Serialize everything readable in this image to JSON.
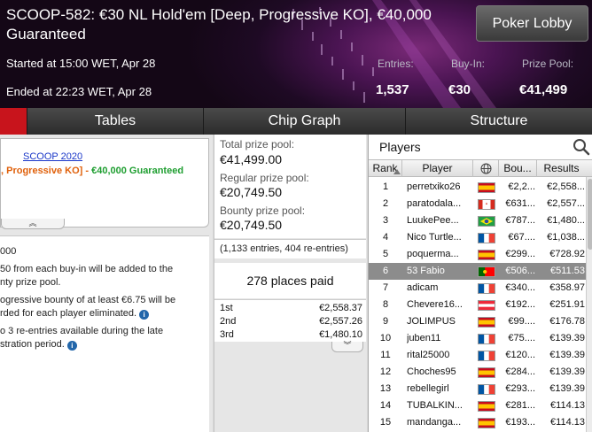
{
  "header": {
    "title": "SCOOP-582: €30 NL Hold'em [Deep, Progressive KO], €40,000 Guaranteed",
    "started": "Started at 15:00 WET, Apr 28",
    "ended": "Ended at 22:23 WET, Apr 28",
    "lobby_button": "Poker Lobby",
    "stats": [
      {
        "label": "Entries:",
        "value": "1,537"
      },
      {
        "label": "Buy-In:",
        "value": "€30"
      },
      {
        "label": "Prize Pool:",
        "value": "€41,499"
      }
    ]
  },
  "tabs": [
    {
      "label": ""
    },
    {
      "label": "Tables"
    },
    {
      "label": "Chip Graph"
    },
    {
      "label": "Structure"
    }
  ],
  "info": {
    "series_link": "SCOOP 2020",
    "name_part": ", Progressive KO] - ",
    "guarantee": "€40,000 Guaranteed",
    "expand_glyph": "︽"
  },
  "rules": [
    "000",
    "50 from each buy-in will be added to the",
    "nty prize pool.",
    "ogressive bounty of at least €6.75 will be",
    "rded for each player eliminated.",
    "o 3 re-entries available during the late",
    "stration period."
  ],
  "info_icon": "i",
  "prize": {
    "total_label": "Total prize pool:",
    "total_value": "€41,499.00",
    "regular_label": "Regular prize pool:",
    "regular_value": "€20,749.50",
    "bounty_label": "Bounty prize pool:",
    "bounty_value": "€20,749.50",
    "entries_note": "(1,133 entries, 404 re-entries)",
    "places_paid": "278 places paid",
    "payouts": [
      {
        "place": "1st",
        "amount": "€2,558.37"
      },
      {
        "place": "2nd",
        "amount": "€2,557.26"
      },
      {
        "place": "3rd",
        "amount": "€1,480.10"
      }
    ],
    "expand_glyph": "︾"
  },
  "players": {
    "title": "Players",
    "columns": {
      "rank": "Rank",
      "player": "Player",
      "bounty": "Bou...",
      "results": "Results"
    },
    "rows": [
      {
        "rank": "1",
        "name": "perretxiko26",
        "flag": "es",
        "bounty": "€2,2...",
        "result": "€2,558..."
      },
      {
        "rank": "2",
        "name": "paratodala...",
        "flag": "ca",
        "bounty": "€631...",
        "result": "€2,557..."
      },
      {
        "rank": "3",
        "name": "LuukePee...",
        "flag": "br",
        "bounty": "€787...",
        "result": "€1,480..."
      },
      {
        "rank": "4",
        "name": "Nico Turtle...",
        "flag": "fr",
        "bounty": "€67....",
        "result": "€1,038..."
      },
      {
        "rank": "5",
        "name": "poquerma...",
        "flag": "es",
        "bounty": "€299...",
        "result": "€728.92"
      },
      {
        "rank": "6",
        "name": "53 Fabio",
        "flag": "pt",
        "bounty": "€506...",
        "result": "€511.53",
        "selected": true
      },
      {
        "rank": "7",
        "name": "adicam",
        "flag": "fr",
        "bounty": "€340...",
        "result": "€358.97"
      },
      {
        "rank": "8",
        "name": "Chevere16...",
        "flag": "at",
        "bounty": "€192...",
        "result": "€251.91"
      },
      {
        "rank": "9",
        "name": "JOLIMPUS",
        "flag": "es",
        "bounty": "€99....",
        "result": "€176.78"
      },
      {
        "rank": "10",
        "name": "juben11",
        "flag": "fr",
        "bounty": "€75....",
        "result": "€139.39"
      },
      {
        "rank": "11",
        "name": "rital25000",
        "flag": "fr",
        "bounty": "€120...",
        "result": "€139.39"
      },
      {
        "rank": "12",
        "name": "Choches95",
        "flag": "es",
        "bounty": "€284...",
        "result": "€139.39"
      },
      {
        "rank": "13",
        "name": "rebellegirl",
        "flag": "fr",
        "bounty": "€293...",
        "result": "€139.39"
      },
      {
        "rank": "14",
        "name": "TUBALKIN...",
        "flag": "es",
        "bounty": "€281...",
        "result": "€114.13"
      },
      {
        "rank": "15",
        "name": "mandanga...",
        "flag": "es",
        "bounty": "€193...",
        "result": "€114.13"
      }
    ]
  },
  "colors": {
    "accent_red": "#c8141c",
    "selected_row": "#8c8c8c",
    "link_blue": "#1a37c8",
    "orange": "#e0600a",
    "green": "#1e9e30"
  }
}
